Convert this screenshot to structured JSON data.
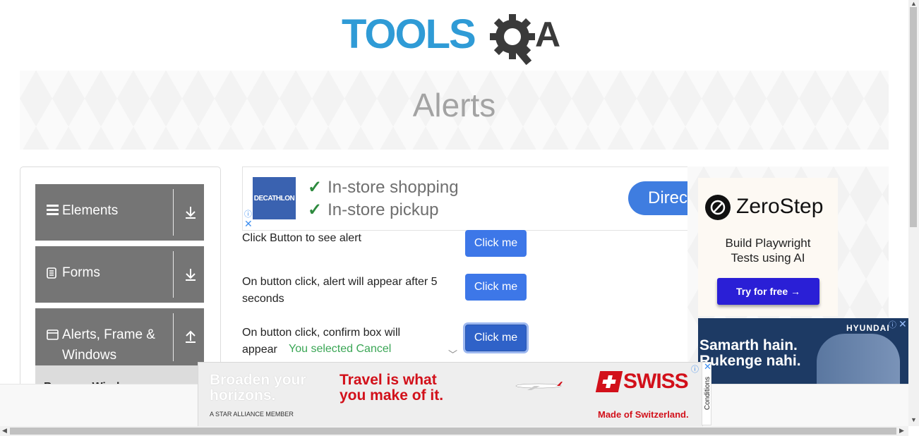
{
  "logo": {
    "part1": "TOOLS",
    "part2": "A"
  },
  "page_title": "Alerts",
  "sidebar": {
    "groups": [
      {
        "label": "Elements",
        "icon": "hamburger-icon",
        "arrow": "download-icon"
      },
      {
        "label": "Forms",
        "icon": "document-icon",
        "arrow": "download-icon"
      },
      {
        "label": "Alerts, Frame &",
        "label2": "Windows",
        "icon": "window-icon",
        "arrow": "upload-icon"
      }
    ],
    "submenu_partial": "Browser Windows"
  },
  "top_ad": {
    "brand": "DECATHLON",
    "line1": "In-store shopping",
    "line2": "In-store pickup",
    "cta": "Direc"
  },
  "alerts": [
    {
      "label": "Click Button to see alert",
      "button": "Click me"
    },
    {
      "label": "On button click, alert will appear after 5",
      "label2": "seconds",
      "button": "Click me"
    },
    {
      "label": "On button click, confirm box will",
      "label2": "appear",
      "button": "Click me",
      "result": "You selected Cancel"
    }
  ],
  "right_ad": {
    "brand": "ZeroStep",
    "tagline1": "Build Playwright",
    "tagline2": "Tests using AI",
    "cta": "Try for free →"
  },
  "hyundai_ad": {
    "brand": "HYUNDAI",
    "line1": "Samarth hain.",
    "line2": "Rukenge nahi."
  },
  "swiss_ad": {
    "left1": "Broaden your",
    "left2": "horizons.",
    "member": "A STAR ALLIANCE MEMBER",
    "mid1": "Travel is what",
    "mid2": "you make of it.",
    "brand": "SWISS",
    "made": "Made of Switzerland.",
    "conditions": "Conditions"
  },
  "colors": {
    "logo_blue": "#2f9bd6",
    "logo_dark": "#3a3a3a",
    "button_blue": "#3d77e8",
    "sidebar_gray": "#757575",
    "success_green": "#3aa655",
    "swiss_red": "#d2101a",
    "zerostep_purple": "#2a1fd6"
  }
}
